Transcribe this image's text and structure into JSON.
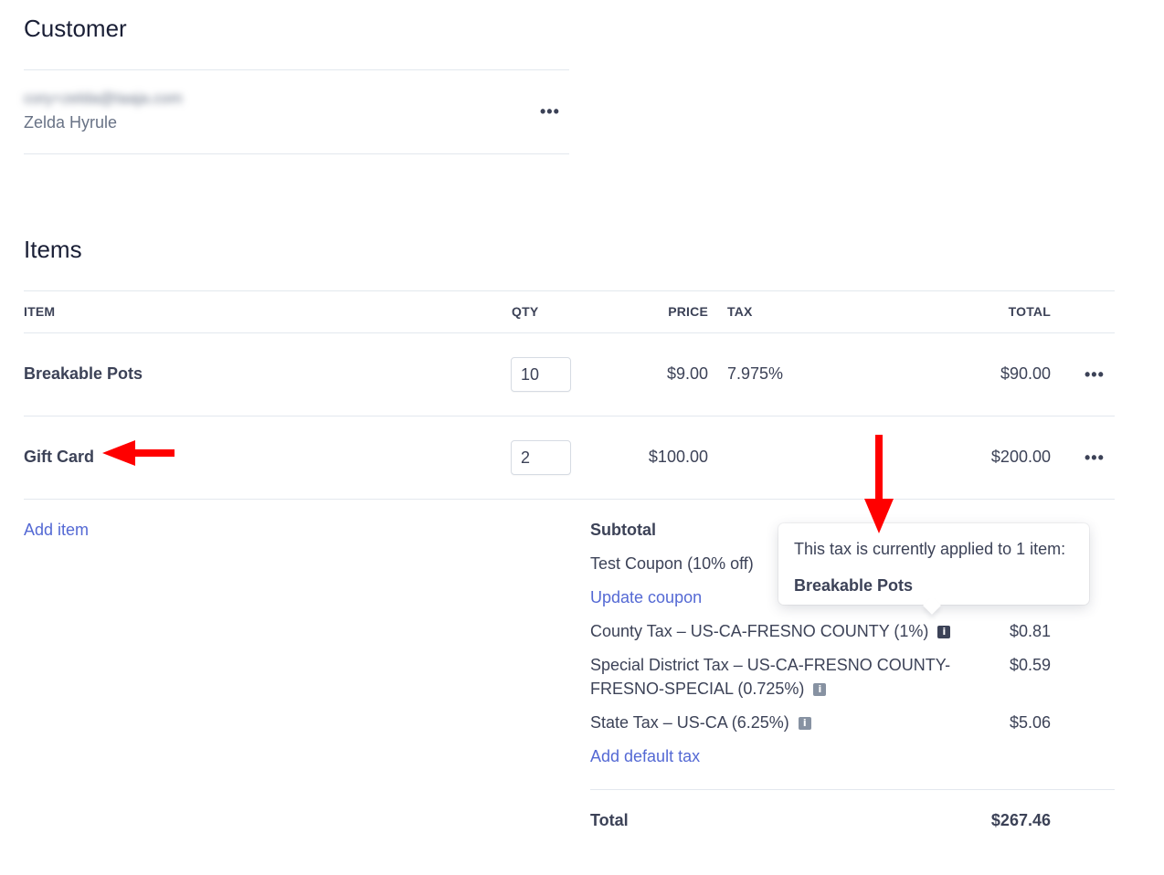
{
  "customer": {
    "heading": "Customer",
    "email_blurred": "cory+zelda@taaja.com",
    "name": "Zelda Hyrule",
    "more_label": "•••"
  },
  "items": {
    "heading": "Items",
    "columns": {
      "item": "ITEM",
      "qty": "QTY",
      "price": "PRICE",
      "tax": "TAX",
      "total": "TOTAL"
    },
    "rows": [
      {
        "name": "Breakable Pots",
        "qty": "10",
        "price": "$9.00",
        "tax": "7.975%",
        "total": "$90.00"
      },
      {
        "name": "Gift Card",
        "qty": "2",
        "price": "$100.00",
        "tax": "",
        "total": "$200.00"
      }
    ],
    "add_item": "Add item",
    "more_label": "•••"
  },
  "summary": {
    "subtotal_label": "Subtotal",
    "coupon_label": "Test Coupon (10% off)",
    "update_coupon": "Update coupon",
    "taxes": [
      {
        "label": "County Tax – US-CA-FRESNO COUNTY (1%)",
        "amount": "$0.81"
      },
      {
        "label_line1": "Special District Tax – US-CA-FRESNO COUNTY-",
        "label_line2": "FRESNO-SPECIAL (0.725%)",
        "amount": "$0.59"
      },
      {
        "label": "State Tax – US-CA (6.25%)",
        "amount": "$5.06"
      }
    ],
    "add_default_tax": "Add default tax",
    "total_label": "Total",
    "total_value": "$267.46",
    "info_glyph": "i"
  },
  "tooltip": {
    "line1": "This tax is currently applied to 1 item:",
    "line2": "Breakable Pots"
  },
  "annotations": {
    "arrow_color": "#ff0000"
  }
}
